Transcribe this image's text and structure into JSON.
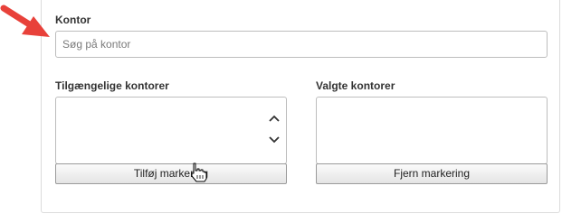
{
  "office": {
    "label": "Kontor",
    "search_placeholder": "Søg på kontor"
  },
  "available": {
    "label": "Tilgængelige kontorer",
    "items": [
      "",
      "",
      "",
      "",
      ""
    ],
    "add_button_label": "Tilføj markering"
  },
  "selected": {
    "label": "Valgte kontorer",
    "items": [],
    "remove_button_label": "Fjern markering"
  },
  "icons": {
    "annotation": "red-arrow-icon",
    "scroll_up": "chevron-up-icon",
    "scroll_down": "chevron-down-icon",
    "cursor": "hand-cursor-icon"
  },
  "colors": {
    "annotation_arrow": "#e8413a",
    "border": "#bdbdbd",
    "label_text": "#333333"
  }
}
